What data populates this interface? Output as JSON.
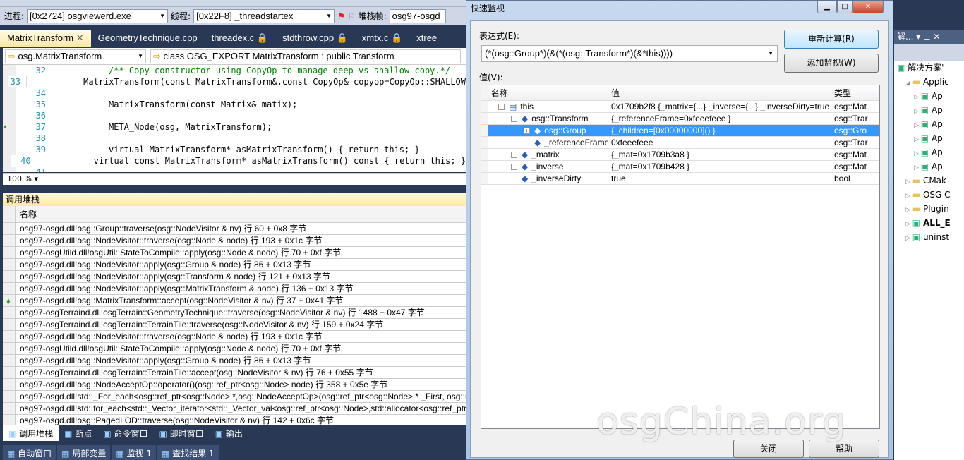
{
  "toolbar": {
    "process_label": "进程:",
    "process_value": "[0x2724] osgviewerd.exe",
    "thread_label": "线程:",
    "thread_value": "[0x22F8] _threadstartex",
    "stackframe_label": "堆栈帧:",
    "stackframe_value": "osg97-osgd"
  },
  "tabs": [
    {
      "label": "MatrixTransform",
      "active": true
    },
    {
      "label": "GeometryTechnique.cpp"
    },
    {
      "label": "threadex.c 🔒"
    },
    {
      "label": "stdthrow.cpp 🔒"
    },
    {
      "label": "xmtx.c 🔒"
    },
    {
      "label": "xtree"
    }
  ],
  "editor": {
    "scope": "osg.MatrixTransform",
    "member": "class OSG_EXPORT MatrixTransform : public Transform",
    "zoom": "100 %",
    "lines": [
      {
        "n": "32",
        "text": "/** Copy constructor using CopyOp to manage deep vs shallow copy.*/",
        "cls": "cm"
      },
      {
        "n": "33",
        "text": "MatrixTransform(const MatrixTransform&,const CopyOp& copyop=CopyOp::SHALLOW"
      },
      {
        "n": "34",
        "text": ""
      },
      {
        "n": "35",
        "text": "MatrixTransform(const Matrix& matix);"
      },
      {
        "n": "36",
        "text": ""
      },
      {
        "n": "37",
        "text": "META_Node(osg, MatrixTransform);",
        "current": true
      },
      {
        "n": "38",
        "text": ""
      },
      {
        "n": "39",
        "text": "virtual MatrixTransform* asMatrixTransform() { return this; }"
      },
      {
        "n": "40",
        "text": "virtual const MatrixTransform* asMatrixTransform() const { return this; }"
      },
      {
        "n": "41",
        "text": ""
      }
    ]
  },
  "callstack": {
    "title": "调用堆栈",
    "header": "名称",
    "rows": [
      "osg97-osgd.dll!osg::Group::traverse(osg::NodeVisitor & nv)  行 60 + 0x8 字节",
      "osg97-osgd.dll!osg::NodeVisitor::traverse(osg::Node & node)  行 193 + 0x1c 字节",
      "osg97-osgUtild.dll!osgUtil::StateToCompile::apply(osg::Node & node)  行 70 + 0xf 字节",
      "osg97-osgd.dll!osg::NodeVisitor::apply(osg::Group & node)  行 86 + 0x13 字节",
      "osg97-osgd.dll!osg::NodeVisitor::apply(osg::Transform & node)  行 121 + 0x13 字节",
      "osg97-osgd.dll!osg::NodeVisitor::apply(osg::MatrixTransform & node)  行 136 + 0x13 字节",
      "osg97-osgd.dll!osg::MatrixTransform::accept(osg::NodeVisitor & nv)  行 37 + 0x41 字节",
      "osg97-osgTerraind.dll!osgTerrain::GeometryTechnique::traverse(osg::NodeVisitor & nv)  行 1488 + 0x47 字节",
      "osg97-osgTerraind.dll!osgTerrain::TerrainTile::traverse(osg::NodeVisitor & nv)  行 159 + 0x24 字节",
      "osg97-osgd.dll!osg::NodeVisitor::traverse(osg::Node & node)  行 193 + 0x1c 字节",
      "osg97-osgUtild.dll!osgUtil::StateToCompile::apply(osg::Node & node)  行 70 + 0xf 字节",
      "osg97-osgd.dll!osg::NodeVisitor::apply(osg::Group & node)  行 86 + 0x13 字节",
      "osg97-osgTerraind.dll!osgTerrain::TerrainTile::accept(osg::NodeVisitor & nv)  行 76 + 0x55 字节",
      "osg97-osgd.dll!osg::NodeAcceptOp::operator()(osg::ref_ptr<osg::Node> node)  行 358 + 0x5e 字节",
      "osg97-osgd.dll!std::_For_each<osg::ref_ptr<osg::Node> *,osg::NodeAcceptOp>(osg::ref_ptr<osg::Node> * _First, osg::re",
      "osg97-osgd.dll!std::for_each<std::_Vector_iterator<std::_Vector_val<osg::ref_ptr<osg::Node>,std::allocator<osg::ref_ptr<",
      "osg97-osgd.dll!osg::PagedLOD::traverse(osg::NodeVisitor & nv)  行 142 + 0x6c 字节"
    ],
    "current_index": 6
  },
  "bottom_tabs": [
    "调用堆栈",
    "断点",
    "命令窗口",
    "即时窗口",
    "输出"
  ],
  "bottom_tabs2": [
    "自动窗口",
    "局部变量",
    "监视 1",
    "查找结果 1"
  ],
  "quickwatch": {
    "title": "快速监视",
    "expr_label": "表达式(E):",
    "expr_value": "(*(osg::Group*)(&(*(osg::Transform*)(&*this))))",
    "recalc": "重新计算(R)",
    "add_watch": "添加监视(W)",
    "value_label": "值(V):",
    "columns": [
      "名称",
      "值",
      "类型"
    ],
    "rows": [
      {
        "name": "this",
        "value": "0x1709b2f8 {_matrix={...} _inverse={...} _inverseDirty=true }",
        "type": "osg::Mat",
        "indent": 0,
        "exp": "−"
      },
      {
        "name": "osg::Transform",
        "value": "{_referenceFrame=0xfeeefeee }",
        "type": "osg::Trar",
        "indent": 1,
        "exp": "−"
      },
      {
        "name": "osg::Group",
        "value": "{_children=[0x00000000]() }",
        "type": "osg::Gro",
        "indent": 2,
        "exp": "+",
        "selected": true
      },
      {
        "name": "_referenceFrame",
        "value": "0xfeeefeee",
        "type": "osg::Trar",
        "indent": 2,
        "exp": ""
      },
      {
        "name": "_matrix",
        "value": "{_mat=0x1709b3a8 }",
        "type": "osg::Mat",
        "indent": 1,
        "exp": "+"
      },
      {
        "name": "_inverse",
        "value": "{_mat=0x1709b428 }",
        "type": "osg::Mat",
        "indent": 1,
        "exp": "+"
      },
      {
        "name": "_inverseDirty",
        "value": "true",
        "type": "bool",
        "indent": 1,
        "exp": ""
      }
    ],
    "close": "关闭",
    "help": "帮助"
  },
  "solution": {
    "title": "解...",
    "items": [
      {
        "label": "解决方案'",
        "indent": 0
      },
      {
        "label": "Applic",
        "indent": 1,
        "arrow": "◢"
      },
      {
        "label": "Ap",
        "indent": 2,
        "arrow": "▷"
      },
      {
        "label": "Ap",
        "indent": 2,
        "arrow": "▷"
      },
      {
        "label": "Ap",
        "indent": 2,
        "arrow": "▷"
      },
      {
        "label": "Ap",
        "indent": 2,
        "arrow": "▷"
      },
      {
        "label": "Ap",
        "indent": 2,
        "arrow": "▷"
      },
      {
        "label": "Ap",
        "indent": 2,
        "arrow": "▷"
      },
      {
        "label": "CMak",
        "indent": 1,
        "arrow": "▷"
      },
      {
        "label": "OSG C",
        "indent": 1,
        "arrow": "▷"
      },
      {
        "label": "Plugin",
        "indent": 1,
        "arrow": "▷"
      },
      {
        "label": "ALL_E",
        "indent": 1,
        "arrow": "▷",
        "bold": true
      },
      {
        "label": "uninst",
        "indent": 1,
        "arrow": "▷"
      }
    ]
  },
  "watermark": "osgChina.org"
}
